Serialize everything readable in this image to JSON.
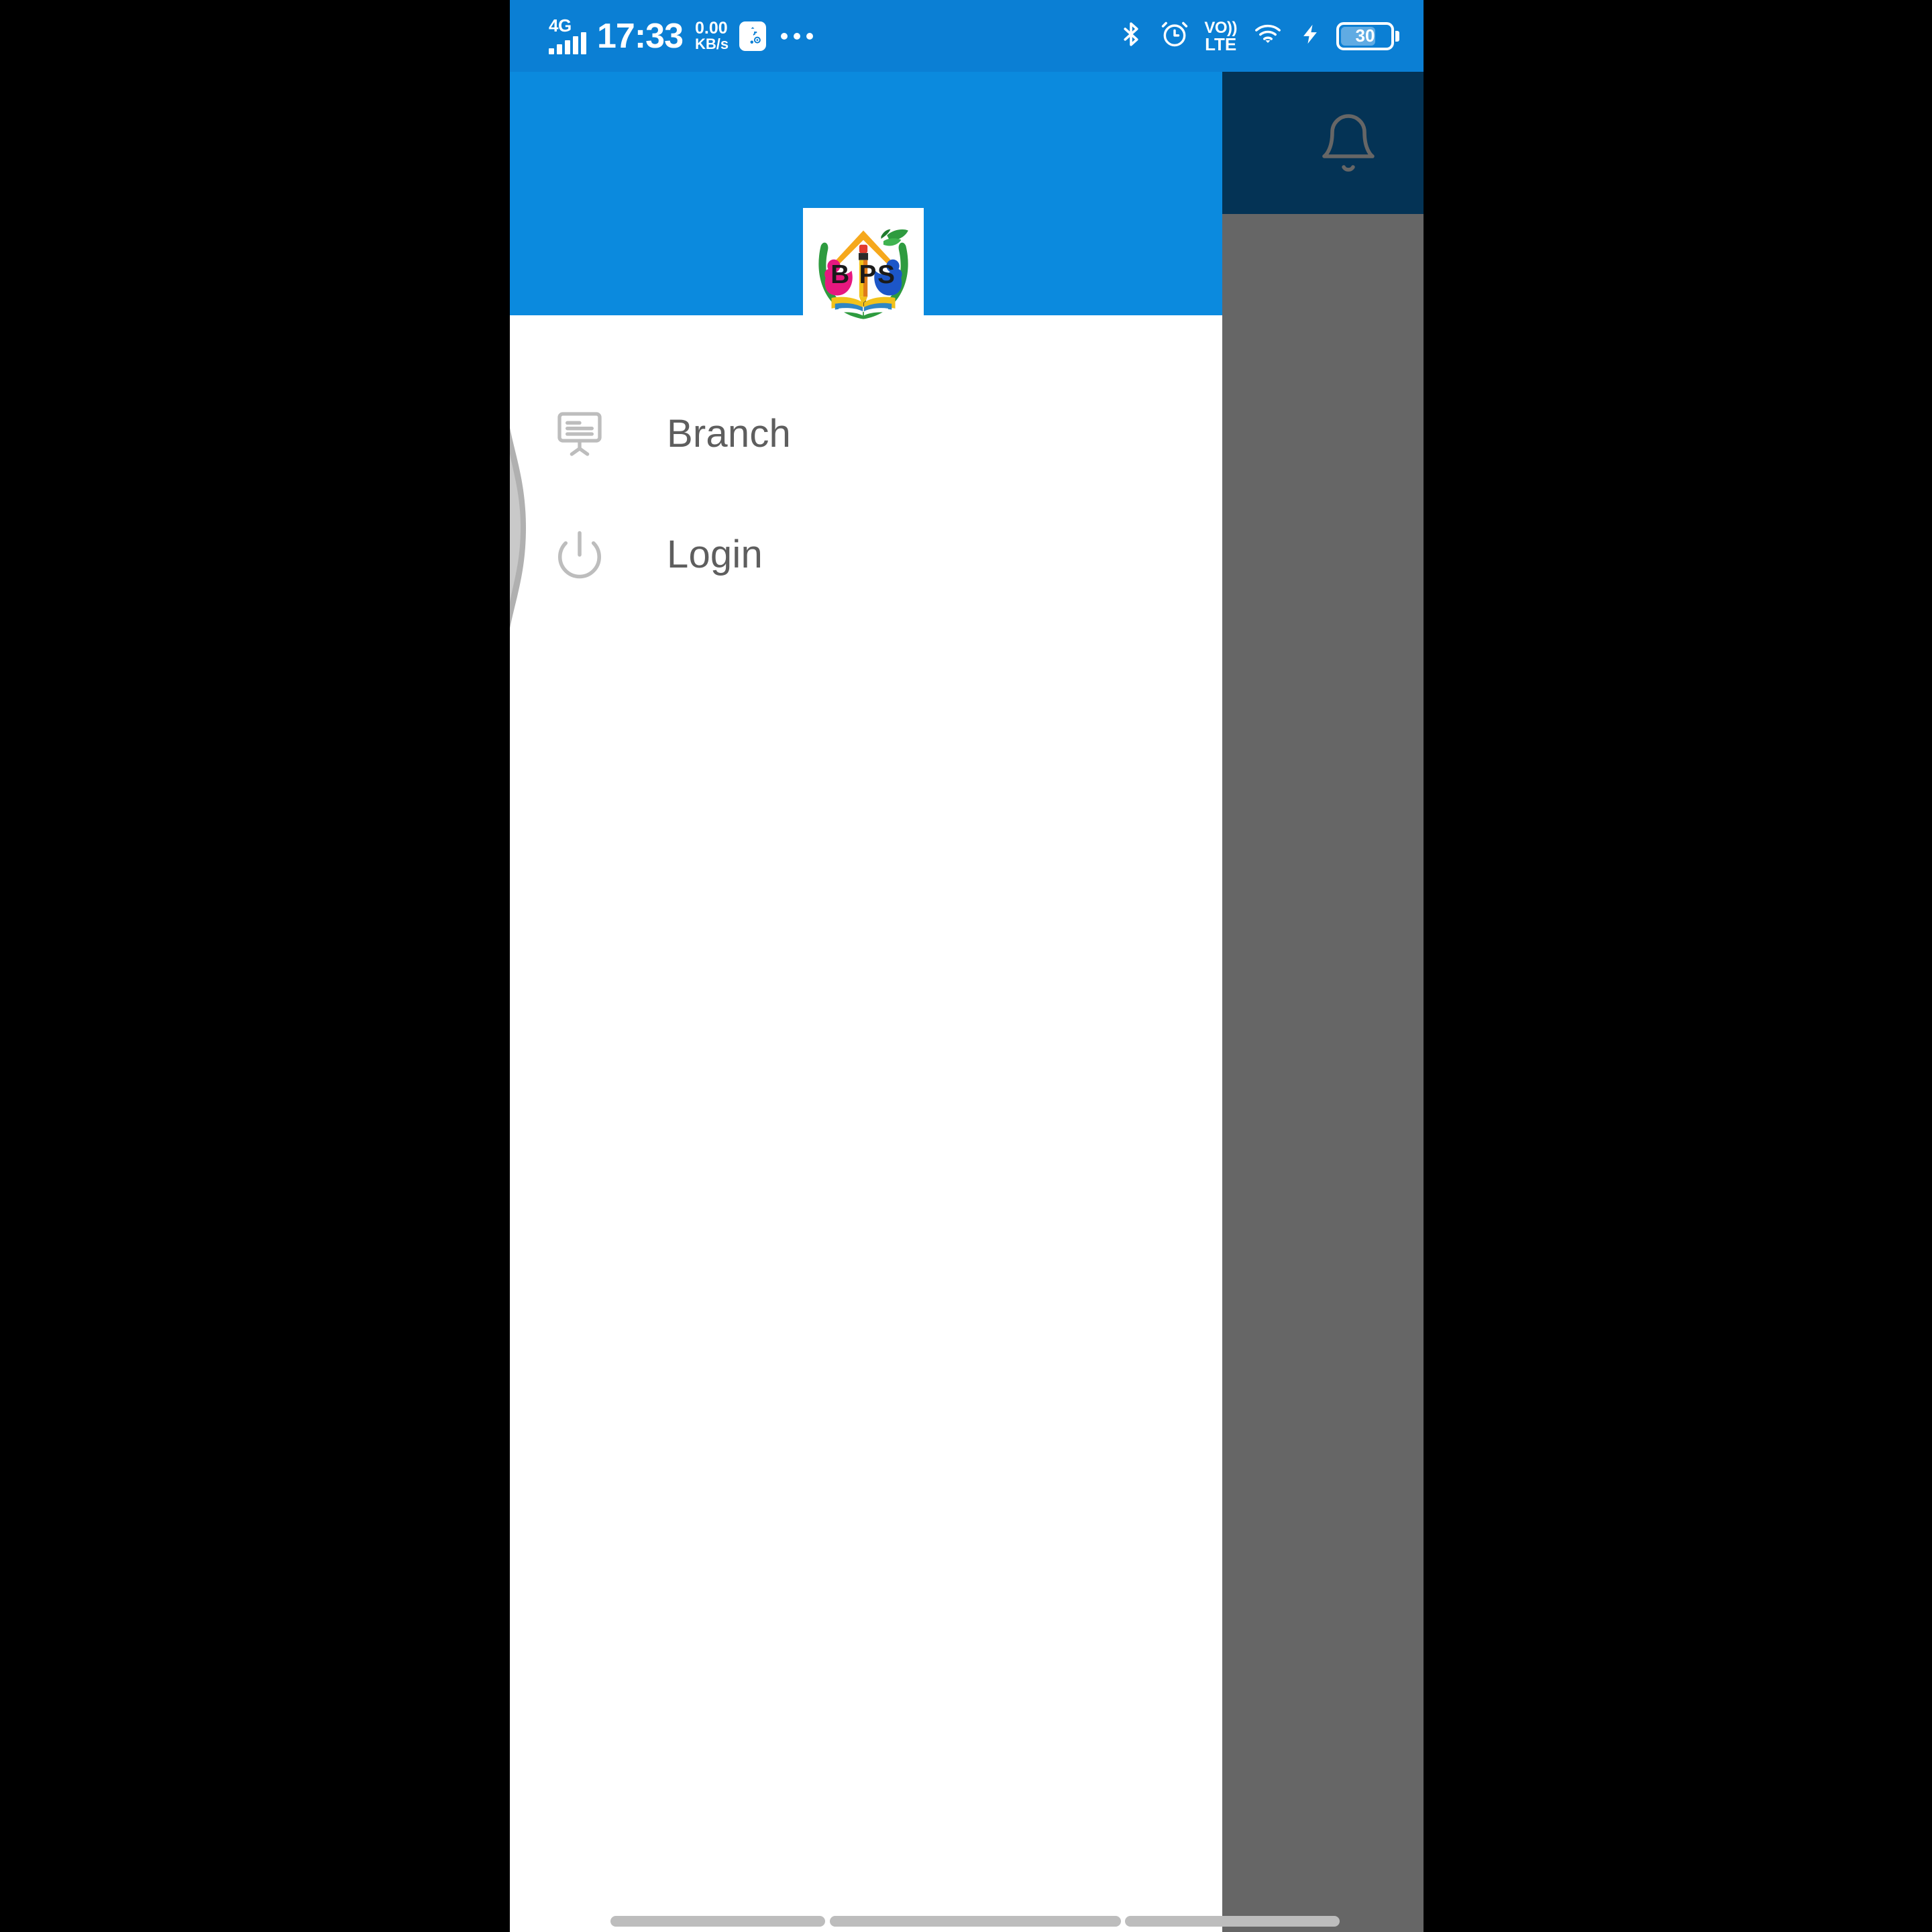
{
  "status_bar": {
    "network_generation": "4G",
    "signal_icon": "signal-bars-icon",
    "time": "17:33",
    "net_speed_value": "0.00",
    "net_speed_unit": "KB/s",
    "usb_debug_icon": "usb-settings-icon",
    "overflow_icon": "more-dots-icon",
    "bluetooth_icon": "bluetooth-icon",
    "alarm_icon": "alarm-clock-icon",
    "volte_top": "VO))",
    "volte_bottom": "LTE",
    "wifi_icon": "wifi-icon",
    "charging_icon": "charging-bolt-icon",
    "battery_percent": "30",
    "background_color": "#0b7fd4"
  },
  "app": {
    "app_bar": {
      "background_color": "#0b7fd4",
      "notification_icon": "bell-icon"
    },
    "scrim_color": "#666666"
  },
  "drawer": {
    "header": {
      "background_color": "#0b8ade",
      "logo_icon": "bips-school-logo",
      "logo_text": "BIPS"
    },
    "items": [
      {
        "label": "Branch",
        "icon": "presentation-board-icon"
      },
      {
        "label": "Login",
        "icon": "power-icon"
      }
    ],
    "background_color": "#ffffff",
    "label_color": "#5e5e5e",
    "edge_gesture_hint_icon": "edge-swipe-hint-icon"
  },
  "navigation_bar": {
    "pills": [
      "recents-pill",
      "home-pill",
      "back-pill"
    ],
    "pill_color": "#bdbdbd"
  }
}
